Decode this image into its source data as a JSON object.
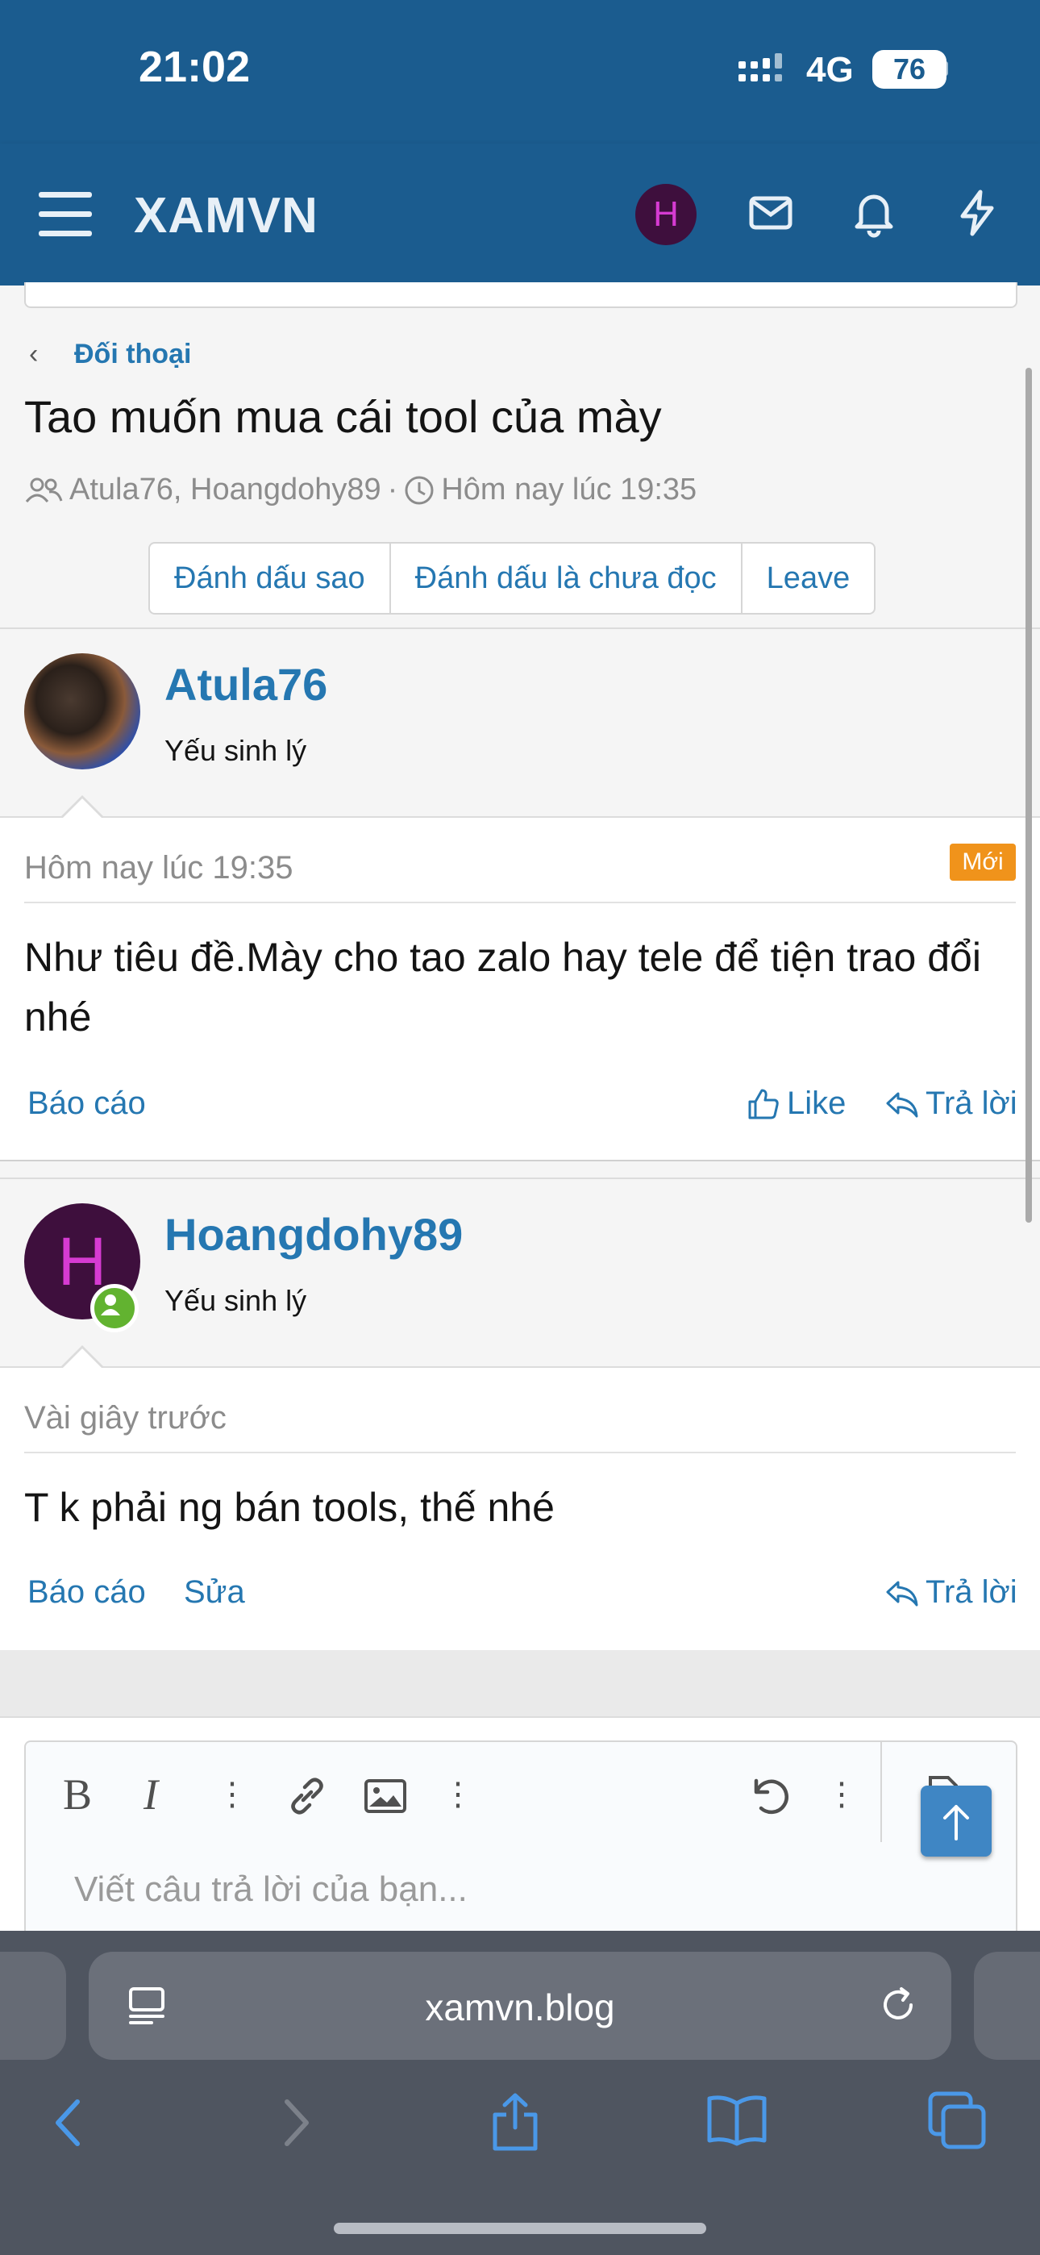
{
  "status_bar": {
    "time": "21:02",
    "network": "4G",
    "battery": "76"
  },
  "nav": {
    "logo": "XAMVN",
    "avatar_letter": "H"
  },
  "breadcrumb": {
    "label": "Đối thoại"
  },
  "thread": {
    "title": "Tao muốn mua cái tool của mày",
    "participants": "Atula76, Hoangdohy89",
    "separator": "·",
    "date": "Hôm nay lúc 19:35"
  },
  "actions": {
    "star": "Đánh dấu sao",
    "unread": "Đánh dấu là chưa đọc",
    "leave": "Leave"
  },
  "messages": [
    {
      "user": "Atula76",
      "user_title": "Yếu sinh lý",
      "time": "Hôm nay lúc 19:35",
      "badge": "Mới",
      "text": "Như tiêu đề.Mày cho tao zalo hay tele để tiện trao đổi nhé",
      "report": "Báo cáo",
      "like": "Like",
      "reply": "Trả lời"
    },
    {
      "user": "Hoangdohy89",
      "avatar_letter": "H",
      "user_title": "Yếu sinh lý",
      "time": "Vài giây trước",
      "text": "T k phải ng bán tools, thế nhé",
      "report": "Báo cáo",
      "edit": "Sửa",
      "reply": "Trả lời"
    }
  ],
  "editor": {
    "placeholder": "Viết câu trả lời của bạn..."
  },
  "browser": {
    "url": "xamvn.blog"
  },
  "colors": {
    "brand": "#1b5c8f",
    "link": "#2577b1",
    "new_badge": "#f0931b",
    "online": "#62b330",
    "avatar_bg": "#3e0f3d"
  }
}
